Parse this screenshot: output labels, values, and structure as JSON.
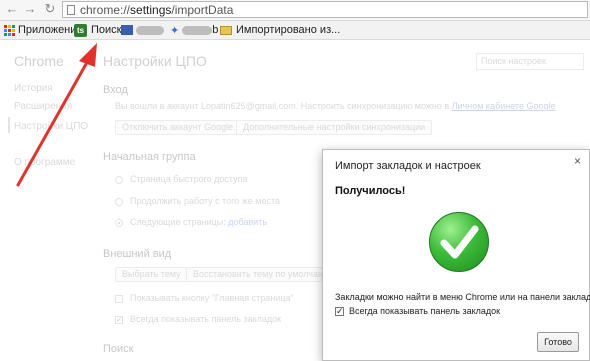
{
  "toolbar": {
    "url_prefix": "chrome://",
    "url_main": "settings",
    "url_suffix": "/importData"
  },
  "bookmarks": {
    "apps_label": "Приложения",
    "search_label": "Поиск",
    "search_icon_text": "ts",
    "folder_label": "Импортировано из...",
    "blurred_suffix": "b"
  },
  "sidebar": {
    "title": "Chrome",
    "items": [
      "История",
      "Расширения",
      "Настройки ЦПО",
      "О программе"
    ]
  },
  "main": {
    "title": "Настройки ЦПО",
    "search_placeholder": "Поиск настроек",
    "login": {
      "heading": "Вход",
      "text": "Вы вошли в аккаунт Lopatin625@gmail.com. Настроить синхронизацию можно в",
      "link": "Личном кабинете Google",
      "btn_disconnect": "Отключить аккаунт Google...",
      "btn_sync": "Дополнительные настройки синхронизации"
    },
    "start_group": {
      "heading": "Начальная группа",
      "options": [
        "Страница быстрого доступа",
        "Продолжить работу с того же места",
        "Следующие страницы:"
      ],
      "add_link": "добавить"
    },
    "appearance": {
      "heading": "Внешний вид",
      "btn_theme": "Выбрать тему",
      "btn_reset": "Восстановить тему по умолчанию",
      "cb_home": "Показывать кнопку \"Главная страница\"",
      "cb_bookmarks": "Всегда показывать панель закладок"
    },
    "search_heading": "Поиск"
  },
  "dialog": {
    "title": "Импорт закладок и настроек",
    "close": "×",
    "success": "Получилось!",
    "info": "Закладки можно найти в меню Chrome или на панели закладок.",
    "checkbox_label": "Всегда показывать панель закладок",
    "checkbox_checked": true,
    "done_button": "Готово"
  },
  "colors": {
    "arrow": "#e0332b",
    "success_green": "#3dbb3a"
  }
}
